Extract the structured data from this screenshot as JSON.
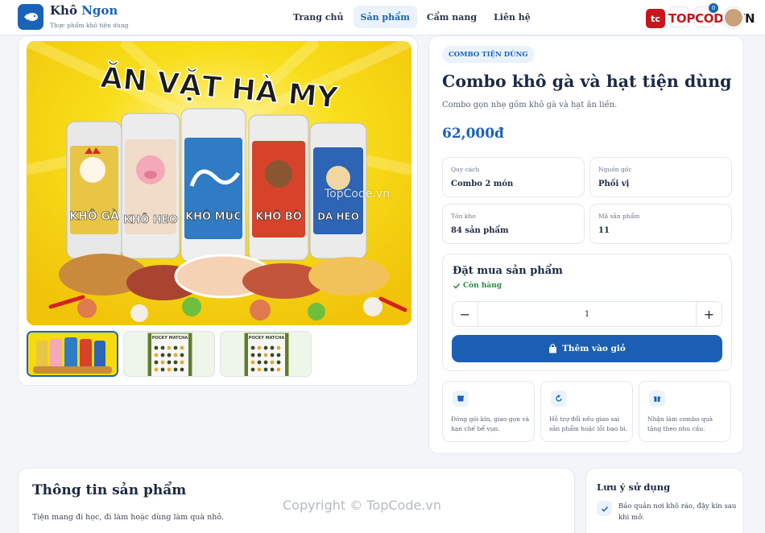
{
  "header": {
    "brand_main": "Khô",
    "brand_accent": "Ngon",
    "tagline": "Thực phẩm khô tiện dùng",
    "nav": [
      "Trang chủ",
      "Sản phẩm",
      "Cẩm nang",
      "Liên hệ"
    ],
    "active_nav": "Sản phẩm",
    "cart_count": "0",
    "topcode_logo": {
      "mark": "tc",
      "brand_red": "TOPCODE",
      "brand_dark": ".VN"
    }
  },
  "gallery": {
    "banner_text": "ĂN VẶT HÀ MY",
    "jar_labels": [
      "KHÔ GÀ",
      "KHÔ HEO",
      "KHÔ MỰC",
      "KHÔ BÒ",
      "DA HEO"
    ],
    "thumbnails": [
      {
        "name": "thumb-combo",
        "active": true
      },
      {
        "name": "thumb-pocky-1",
        "caption": "POCKY MATCHA",
        "active": false
      },
      {
        "name": "thumb-pocky-2",
        "caption": "POCKY MATCHA",
        "active": false
      }
    ]
  },
  "product": {
    "badge": "COMBO TIỆN DÙNG",
    "title": "Combo khô gà và hạt tiện dùng",
    "description": "Combo gọn nhẹ gồm khô gà và hạt ăn liền.",
    "price": "62,000đ",
    "specs": [
      {
        "label": "Quy cách",
        "value": "Combo 2 món"
      },
      {
        "label": "Nguồn gốc",
        "value": "Phối vị"
      },
      {
        "label": "Tồn kho",
        "value": "84 sản phẩm"
      },
      {
        "label": "Mã sản phẩm",
        "value": "11"
      }
    ]
  },
  "order": {
    "title": "Đặt mua sản phẩm",
    "stock_status": "Còn hàng",
    "quantity": "1",
    "add_to_cart": "Thêm vào giỏ"
  },
  "features": [
    {
      "icon": "box-icon",
      "text": "Đóng gói kín, giao gọn và hạn chế bể vụn."
    },
    {
      "icon": "refresh-icon",
      "text": "Hỗ trợ đổi nếu giao sai sản phẩm hoặc lỗi bao bì."
    },
    {
      "icon": "gift-icon",
      "text": "Nhận làm combo quà tặng theo nhu cầu."
    }
  ],
  "product_info": {
    "title": "Thông tin sản phẩm",
    "text": "Tiện mang đi học, đi làm hoặc dùng làm quà nhỏ."
  },
  "notes": {
    "title": "Lưu ý sử dụng",
    "items": [
      "Bảo quản nơi khô ráo, đậy kín sau khi mở."
    ]
  },
  "watermarks": {
    "image": "TopCode.vn",
    "page": "Copyright © TopCode.vn"
  },
  "colors": {
    "primary": "#1a63b8",
    "stock_green": "#2b8a48",
    "banner_yellow": "#f6d90f",
    "topcode_red": "#c8161d"
  }
}
